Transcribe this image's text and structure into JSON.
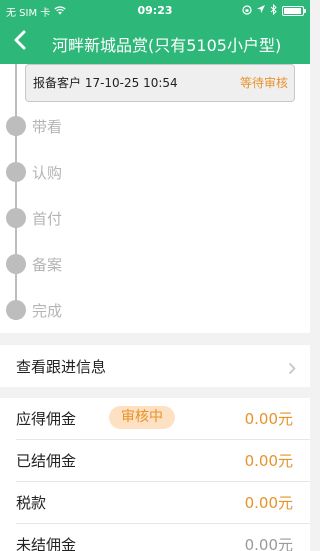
{
  "status_bar": {
    "carrier": "无 SIM 卡",
    "time": "09:23"
  },
  "nav": {
    "title": "河畔新城品赏(只有5105小户型)"
  },
  "timeline": {
    "report": {
      "text": "报备客户 17-10-25 10:54",
      "status": "等待审核"
    },
    "steps": [
      {
        "label": "带看"
      },
      {
        "label": "认购"
      },
      {
        "label": "首付"
      },
      {
        "label": "备案"
      },
      {
        "label": "完成"
      }
    ]
  },
  "follow_up": {
    "label": "查看跟进信息"
  },
  "commission": {
    "rows": [
      {
        "label": "应得佣金",
        "badge": "审核中",
        "value": "0.00元"
      },
      {
        "label": "已结佣金",
        "value": "0.00元"
      },
      {
        "label": "税款",
        "value": "0.00元"
      },
      {
        "label": "未结佣金",
        "value": "0.00元"
      }
    ]
  },
  "colors": {
    "brand": "#2db87a",
    "accent": "#e8922a",
    "badge_bg": "#fde1c2",
    "inactive": "#bdbdbd"
  }
}
